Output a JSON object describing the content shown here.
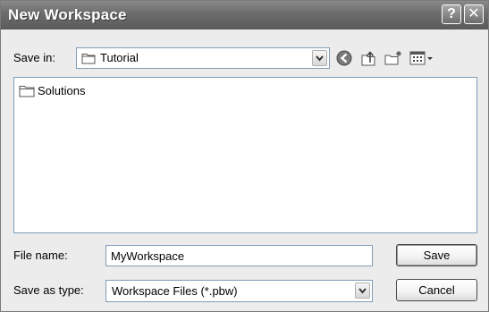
{
  "window": {
    "title": "New Workspace",
    "help_glyph": "?",
    "close_glyph": "✕"
  },
  "save_in": {
    "label": "Save in:",
    "value": "Tutorial",
    "icon": "folder-icon"
  },
  "toolbar": {
    "icons": [
      "back-icon",
      "up-folder-icon",
      "new-folder-icon",
      "view-menu-icon"
    ]
  },
  "file_list": {
    "items": [
      {
        "name": "Solutions",
        "icon": "folder-icon"
      }
    ]
  },
  "file_name": {
    "label": "File name:",
    "value": "MyWorkspace"
  },
  "save_as_type": {
    "label": "Save as type:",
    "value": "Workspace Files (*.pbw)"
  },
  "buttons": {
    "save": "Save",
    "cancel": "Cancel"
  },
  "colors": {
    "title_bar": "#6e6e6e",
    "dialog_bg": "#ececec",
    "field_border": "#7f9db9"
  }
}
